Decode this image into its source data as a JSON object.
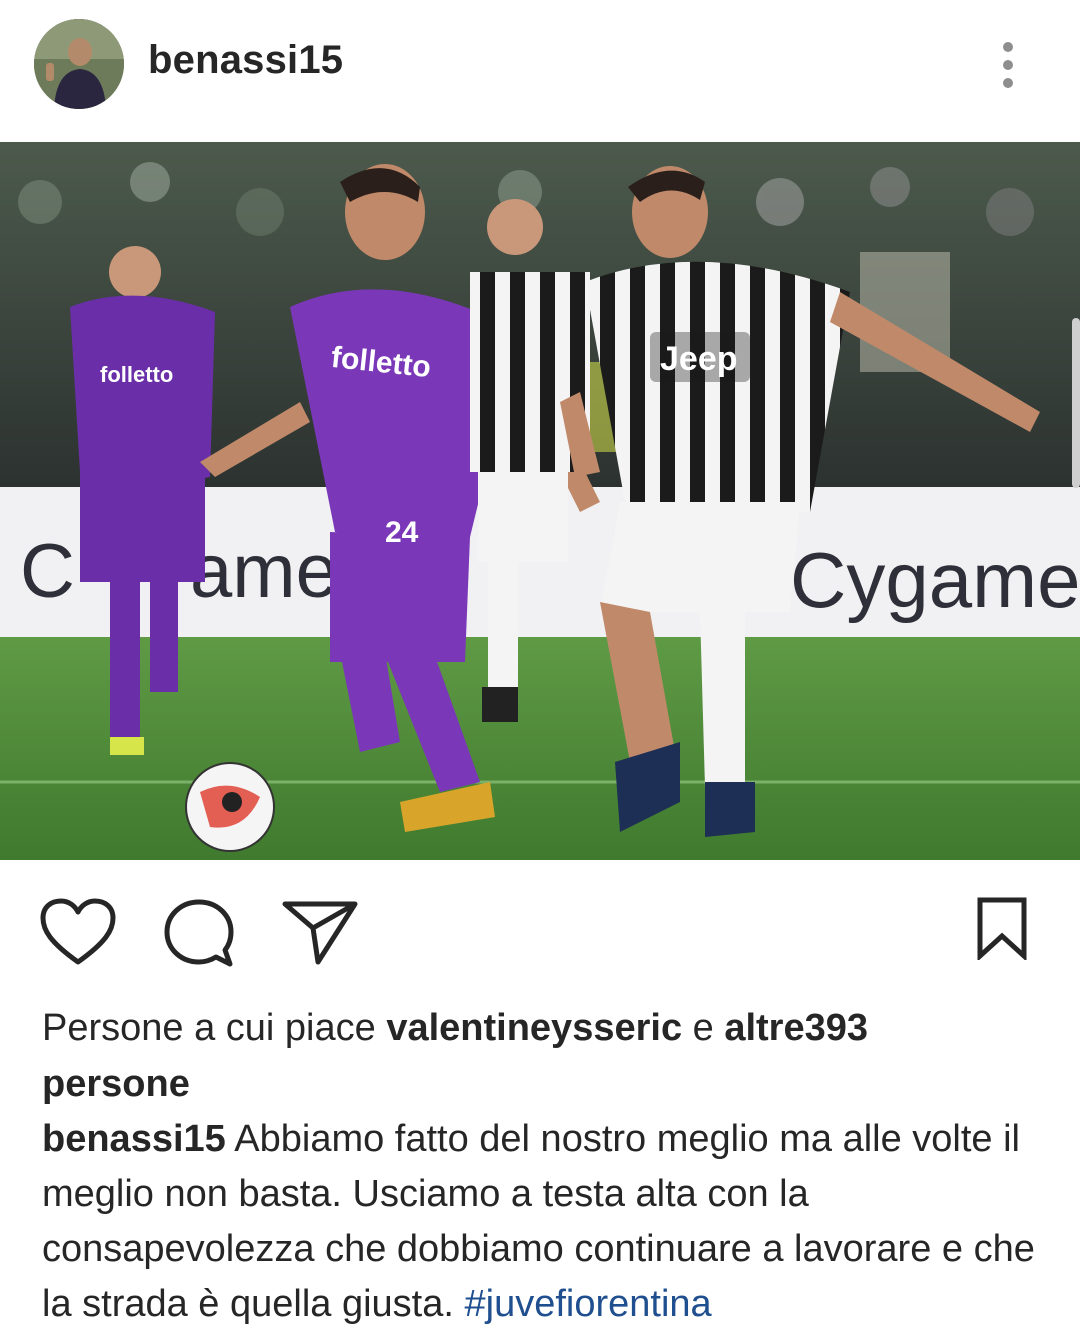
{
  "post": {
    "username": "benassi15",
    "avatar_icon": "profile-avatar",
    "more_icon": "three-dots-vertical-icon"
  },
  "photo": {
    "description_icon": "football-match-photo",
    "jersey_sponsor_left": "folletto",
    "jersey_sponsor_right": "Jeep",
    "ad_board_text": "Cygame",
    "player_number": "24"
  },
  "actions": {
    "like_icon": "heart-icon",
    "comment_icon": "comment-icon",
    "share_icon": "send-icon",
    "save_icon": "bookmark-icon"
  },
  "likes": {
    "prefix": "Persone a cui piace ",
    "user": "valentineysseric",
    "mid": " e ",
    "others": "altre393",
    "suffix": "persone"
  },
  "caption": {
    "username": "benassi15",
    "text": " Abbiamo fatto del nostro meglio ma alle volte il meglio non basta. Usciamo a testa alta con la consapevolezza che dobbiamo continuare a lavorare e che la strada è quella giusta. ",
    "hashtag": "#juvefiorentina"
  },
  "colors": {
    "text": "#262626",
    "hashtag": "#1f4f8f",
    "icon": "#262626"
  }
}
